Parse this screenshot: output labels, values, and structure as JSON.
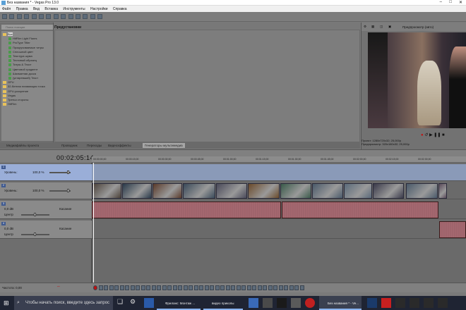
{
  "window": {
    "title": "Без названия * - Vegas Pro 13.0"
  },
  "menu": {
    "items": [
      "Файл",
      "Правка",
      "Вид",
      "Вставка",
      "Инструменты",
      "Настройки",
      "Справка"
    ]
  },
  "explorer": {
    "search_placeholder": "Поиск позиции",
    "tree": [
      {
        "label": "Все",
        "type": "folder",
        "selected": true
      },
      {
        "label": "HitFilm Light Flares",
        "type": "leaf"
      },
      {
        "label": "ProType Titler",
        "type": "leaf"
      },
      {
        "label": "Прокручиваемые титры",
        "type": "leaf"
      },
      {
        "label": "Сплошной цвет",
        "type": "leaf"
      },
      {
        "label": "Текстура шума",
        "type": "leaf"
      },
      {
        "label": "Тестовый образец",
        "type": "leaf"
      },
      {
        "label": "Титры & Текст",
        "type": "leaf"
      },
      {
        "label": "Цветовой градиент",
        "type": "leaf"
      },
      {
        "label": "Шахматная доска",
        "type": "leaf"
      },
      {
        "label": "(устаревший) Текст",
        "type": "leaf"
      },
      {
        "label": "GPU",
        "type": "folder"
      },
      {
        "label": "32-битная плавающая точка",
        "type": "folder"
      },
      {
        "label": "GPU-ускорение",
        "type": "folder"
      },
      {
        "label": "Vegas",
        "type": "folder"
      },
      {
        "label": "Третьи стороны",
        "type": "folder"
      },
      {
        "label": "HitFilm",
        "type": "folder"
      }
    ]
  },
  "presets": {
    "header": "Предустановки"
  },
  "tabs": [
    {
      "label": "Медиафайлы проекта",
      "active": false
    },
    {
      "label": "Проводник",
      "active": false
    },
    {
      "label": "Переходы",
      "active": false
    },
    {
      "label": "Видеоэффекты",
      "active": false
    },
    {
      "label": "Генераторы мультимедиа",
      "active": true
    }
  ],
  "preview": {
    "mode_label": "Предпросмотр (авто)",
    "info_lines": [
      "Проект: 1280x720x32; 25,000p",
      "Предпросмотр: 320x180x32; 25,000p",
      "Кадр:",
      "Отображ.:"
    ],
    "info_values": [
      "1280x720x32; 25,000p",
      "320x180x32; 25,000p"
    ]
  },
  "timeline": {
    "timecode": "00:02:05:14",
    "ruler_ticks": [
      "00:00:00;00",
      "00:00:15;00",
      "00:00:30;00",
      "00:00:45;00",
      "00:01:00;00",
      "00:01:15;00",
      "00:01:30;00",
      "00:01:45;00",
      "00:02:00;00",
      "00:02:15;00",
      "00:02:30;00"
    ],
    "tracks": [
      {
        "num": "1",
        "kind": "video",
        "level_label": "Уровень:",
        "level_value": "100,0 %",
        "selected": true
      },
      {
        "num": "2",
        "kind": "video",
        "level_label": "Уровень:",
        "level_value": "100,0 %",
        "selected": false
      },
      {
        "num": "3",
        "kind": "audio",
        "vol": "0,0 dB",
        "pan": "Центр",
        "mode": "Касание",
        "selected": false
      },
      {
        "num": "4",
        "kind": "audio",
        "vol": "0,0 dB",
        "pan": "Центр",
        "mode": "Касание",
        "selected": false
      }
    ]
  },
  "bottom": {
    "rate_label": "Частота: 0,00"
  },
  "taskbar": {
    "search_placeholder": "Чтобы начать поиск, введите здесь запрос",
    "apps": [
      "Фриланс: Монтаж ...",
      "видео приколы",
      "Без названия * - Ve..."
    ]
  },
  "colors": {
    "selected_track": "#9aaed8",
    "audio_wave": "#8a2030",
    "folder": "#e8c25a"
  }
}
